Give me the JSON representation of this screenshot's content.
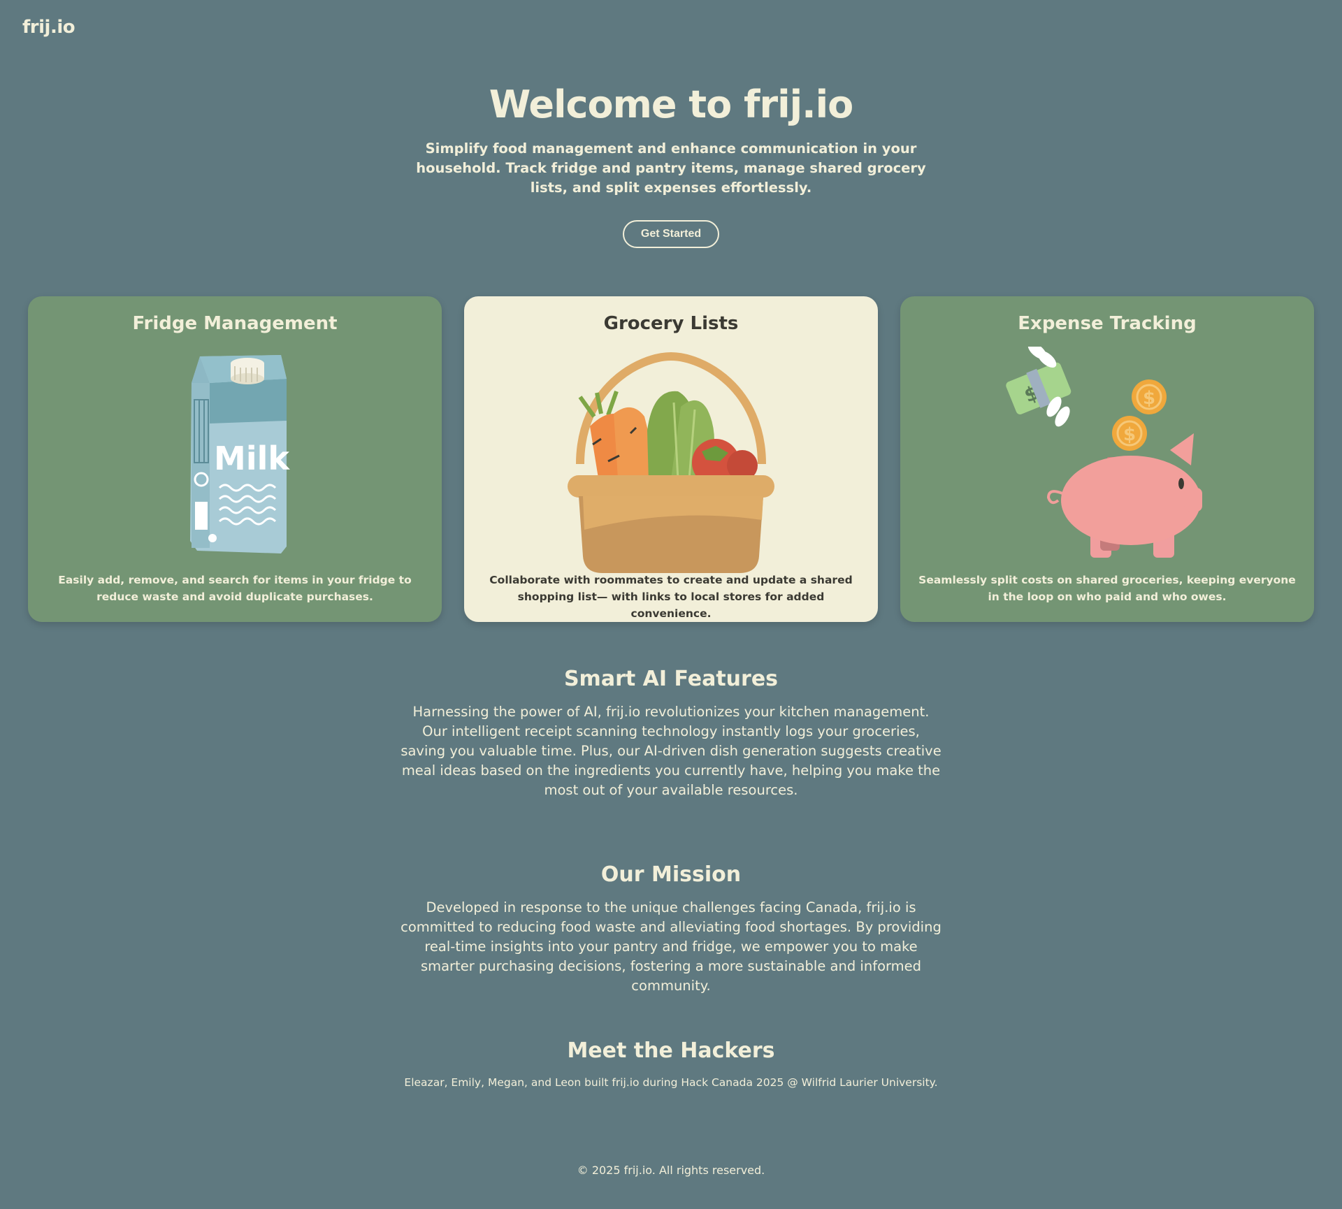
{
  "nav": {
    "logo": "frij.io"
  },
  "hero": {
    "title": "Welcome to frij.io",
    "subtitle": "Simplify food management and enhance communication in your household. Track fridge and pantry items, manage shared grocery lists, and split expenses effortlessly.",
    "cta_label": "Get Started"
  },
  "features": [
    {
      "title": "Fridge Management",
      "description": "Easily add, remove, and search for items in your fridge to reduce waste and avoid duplicate purchases.",
      "illustration": "milk-carton-icon",
      "illustration_text": "Milk"
    },
    {
      "title": "Grocery Lists",
      "description": "Collaborate with roommates to create and update a shared shopping list— with links to local stores for added convenience.",
      "illustration": "grocery-basket-icon"
    },
    {
      "title": "Expense Tracking",
      "description": "Seamlessly split costs on shared groceries, keeping everyone in the loop on who paid and who owes.",
      "illustration": "piggy-bank-icon"
    }
  ],
  "ai": {
    "title": "Smart AI Features",
    "body": "Harnessing the power of AI, frij.io revolutionizes your kitchen management. Our intelligent receipt scanning technology instantly logs your groceries, saving you valuable time. Plus, our AI-driven dish generation suggests creative meal ideas based on the ingredients you currently have, helping you make the most out of your available resources."
  },
  "mission": {
    "title": "Our Mission",
    "body": "Developed in response to the unique challenges facing Canada, frij.io is committed to reducing food waste and alleviating food shortages. By providing real-time insights into your pantry and fridge, we empower you to make smarter purchasing decisions, fostering a more sustainable and informed community."
  },
  "team": {
    "title": "Meet the Hackers",
    "body": "Eleazar, Emily, Megan, and Leon built frij.io during Hack Canada 2025 @ Wilfrid Laurier University."
  },
  "footer": {
    "text": "© 2025 frij.io. All rights reserved."
  },
  "colors": {
    "background": "#5f7980",
    "card_green": "#749574",
    "card_cream": "#f2efd9",
    "text_light": "#f2efd9",
    "text_dark": "#3b3a33"
  }
}
